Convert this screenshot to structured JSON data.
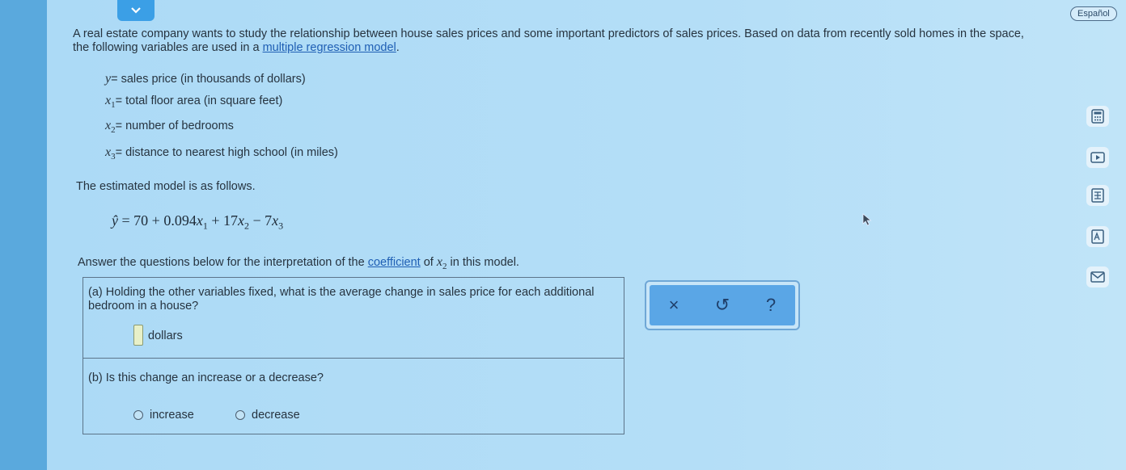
{
  "header": {
    "language_label": "Español"
  },
  "intro": {
    "text_before": "A real estate company wants to study the relationship between house sales prices and some important predictors of sales prices. Based on data from recently sold homes in the space, the following variables are used in a ",
    "link": "multiple regression model",
    "text_after": "."
  },
  "variables": [
    {
      "symbol": "y",
      "sub": "",
      "desc": "sales price (in thousands of dollars)"
    },
    {
      "symbol": "x",
      "sub": "1",
      "desc": "total floor area (in square feet)"
    },
    {
      "symbol": "x",
      "sub": "2",
      "desc": "number of bedrooms"
    },
    {
      "symbol": "x",
      "sub": "3",
      "desc": "distance to nearest high school (in miles)"
    }
  ],
  "model": {
    "title": "The estimated model is as follows.",
    "equation": {
      "lhs": "ŷ",
      "intercept": "70",
      "c1": "0.094",
      "c2": "17",
      "c3": "7"
    }
  },
  "question": {
    "prefix": "Answer the questions below for the interpretation of the ",
    "link": "coefficient",
    "middle": " of ",
    "var": "x",
    "var_sub": "2",
    "suffix": " in this model."
  },
  "part_a": {
    "text": "(a) Holding the other variables fixed, what is the average change in sales price for each additional bedroom in a house?",
    "input_value": "",
    "unit": "dollars"
  },
  "part_b": {
    "text": "(b) Is this change an increase or a decrease?",
    "options": [
      "increase",
      "decrease"
    ]
  },
  "tools": {
    "clear": "×",
    "undo": "↺",
    "help": "?"
  },
  "icons": [
    "calculator-icon",
    "video-icon",
    "data-table-icon",
    "text-icon",
    "mail-icon"
  ],
  "colors": {
    "accent": "#3b9fe6",
    "link": "#1f5fb4",
    "tool_panel": "#5aa6e6"
  }
}
